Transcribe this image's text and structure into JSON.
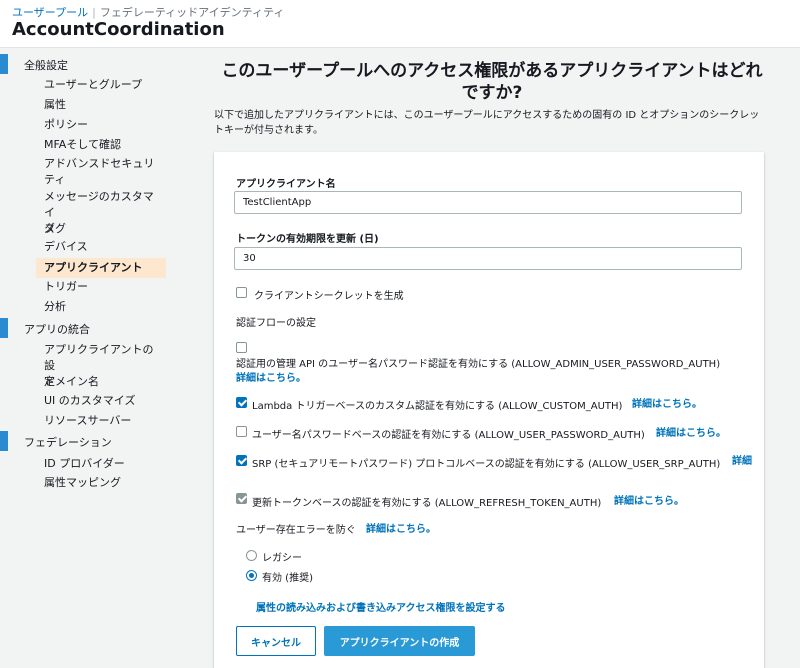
{
  "header": {
    "breadcrumb_link": "ユーザープール",
    "breadcrumb_current": "フェデレーティッドアイデンティティ",
    "title": "AccountCoordination"
  },
  "sidebar": {
    "sections": [
      {
        "label": "全般設定",
        "items": [
          "ユーザーとグループ",
          "属性",
          "ポリシー",
          "MFAそして確認",
          "アドバンスドセキュリ",
          "ティ",
          "メッセージのカスタマイ",
          "ズ",
          "タグ",
          "デバイス",
          "アプリクライアント",
          "トリガー",
          "分析"
        ]
      },
      {
        "label": "アプリの統合",
        "items": [
          "アプリクライアントの設",
          "定",
          "ドメイン名",
          "UI のカスタマイズ",
          "リソースサーバー"
        ]
      },
      {
        "label": "フェデレーション",
        "items": [
          "ID プロバイダー",
          "属性マッピング"
        ]
      }
    ],
    "active_item": "アプリクライアント"
  },
  "main": {
    "heading_line1": "このユーザープールへのアクセス権限があるアプリクライアントはどれ",
    "heading_line2": "ですか?",
    "description_line1": "以下で追加したアプリクライアントには、このユーザープールにアクセスするための固有の ID とオプションのシークレッ",
    "description_line2": "トキーが付与されます。"
  },
  "form": {
    "app_client_name_label": "アプリクライアント名",
    "app_client_name_value": "TestClientApp",
    "token_expiry_label": "トークンの有効期限を更新 (日)",
    "token_expiry_value": "30",
    "generate_secret_label": "クライアントシークレットを生成",
    "generate_secret_checked": false,
    "auth_flow_title": "認証フローの設定",
    "flows": {
      "admin": {
        "label": "認証用の管理 API のユーザー名パスワード認証を有効にする (ALLOW_ADMIN_USER_PASSWORD_AUTH)",
        "link": "詳細はこちら。",
        "checked": false
      },
      "custom": {
        "label": "Lambda トリガーベースのカスタム認証を有効にする (ALLOW_CUSTOM_AUTH)",
        "link": "詳細はこちら。",
        "checked": true
      },
      "user_password": {
        "label": "ユーザー名パスワードベースの認証を有効にする (ALLOW_USER_PASSWORD_AUTH)",
        "link": "詳細はこちら。",
        "checked": false
      },
      "srp": {
        "label": "SRP (セキュアリモートパスワード) プロトコルベースの認証を有効にする (ALLOW_USER_SRP_AUTH)",
        "link": "詳細",
        "checked": true
      },
      "refresh": {
        "label": "更新トークンベースの認証を有効にする (ALLOW_REFRESH_TOKEN_AUTH)",
        "link": "詳細はこちら。",
        "checked": true,
        "disabled": true
      }
    },
    "user_existence_label": "ユーザー存在エラーを防ぐ",
    "user_existence_link": "詳細はこちら。",
    "radio_legacy": "レガシー",
    "radio_enabled": "有効 (推奨)",
    "selected_radio": "有効 (推奨)",
    "attributes_link": "属性の読み込みおよび書き込みアクセス権限を設定する",
    "cancel_button": "キャンセル",
    "create_button": "アプリクライアントの作成"
  },
  "colors": {
    "accent": "#0073bb",
    "primary_button": "#2a9ad7",
    "nav_marker": "#2a8bd1",
    "active_nav_bg": "#fde8cf"
  }
}
